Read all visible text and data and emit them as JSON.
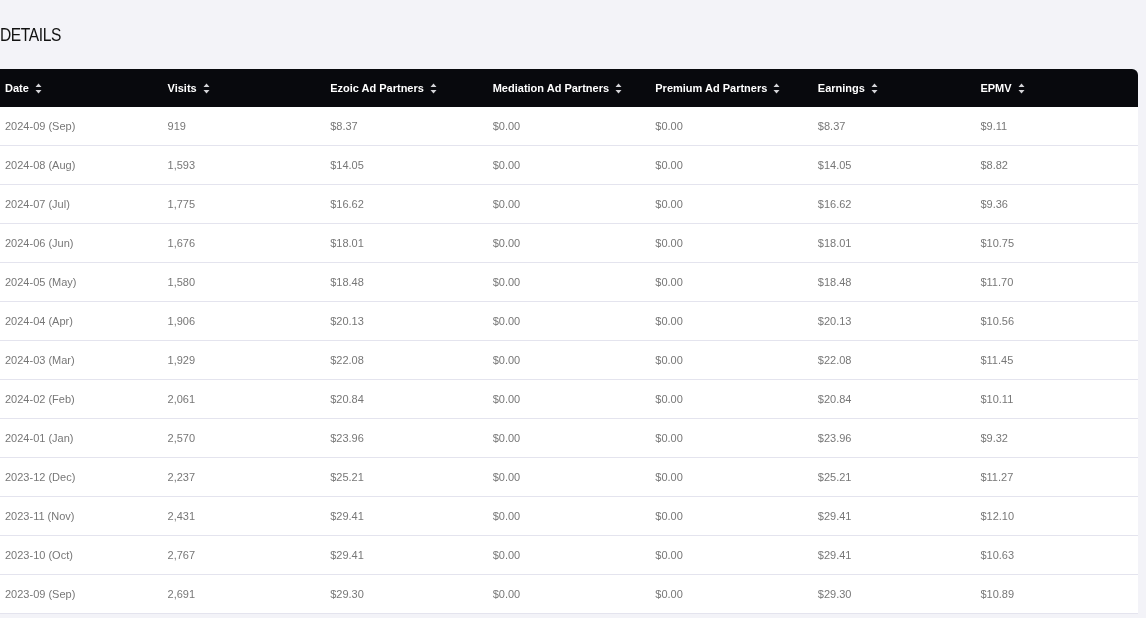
{
  "title": "DETAILS",
  "table": {
    "columns": [
      "Date",
      "Visits",
      "Ezoic Ad Partners",
      "Mediation Ad Partners",
      "Premium Ad Partners",
      "Earnings",
      "EPMV"
    ],
    "rows": [
      [
        "2024-09 (Sep)",
        "919",
        "$8.37",
        "$0.00",
        "$0.00",
        "$8.37",
        "$9.11"
      ],
      [
        "2024-08 (Aug)",
        "1,593",
        "$14.05",
        "$0.00",
        "$0.00",
        "$14.05",
        "$8.82"
      ],
      [
        "2024-07 (Jul)",
        "1,775",
        "$16.62",
        "$0.00",
        "$0.00",
        "$16.62",
        "$9.36"
      ],
      [
        "2024-06 (Jun)",
        "1,676",
        "$18.01",
        "$0.00",
        "$0.00",
        "$18.01",
        "$10.75"
      ],
      [
        "2024-05 (May)",
        "1,580",
        "$18.48",
        "$0.00",
        "$0.00",
        "$18.48",
        "$11.70"
      ],
      [
        "2024-04 (Apr)",
        "1,906",
        "$20.13",
        "$0.00",
        "$0.00",
        "$20.13",
        "$10.56"
      ],
      [
        "2024-03 (Mar)",
        "1,929",
        "$22.08",
        "$0.00",
        "$0.00",
        "$22.08",
        "$11.45"
      ],
      [
        "2024-02 (Feb)",
        "2,061",
        "$20.84",
        "$0.00",
        "$0.00",
        "$20.84",
        "$10.11"
      ],
      [
        "2024-01 (Jan)",
        "2,570",
        "$23.96",
        "$0.00",
        "$0.00",
        "$23.96",
        "$9.32"
      ],
      [
        "2023-12 (Dec)",
        "2,237",
        "$25.21",
        "$0.00",
        "$0.00",
        "$25.21",
        "$11.27"
      ],
      [
        "2023-11 (Nov)",
        "2,431",
        "$29.41",
        "$0.00",
        "$0.00",
        "$29.41",
        "$12.10"
      ],
      [
        "2023-10 (Oct)",
        "2,767",
        "$29.41",
        "$0.00",
        "$0.00",
        "$29.41",
        "$10.63"
      ],
      [
        "2023-09 (Sep)",
        "2,691",
        "$29.30",
        "$0.00",
        "$0.00",
        "$29.30",
        "$10.89"
      ]
    ]
  }
}
